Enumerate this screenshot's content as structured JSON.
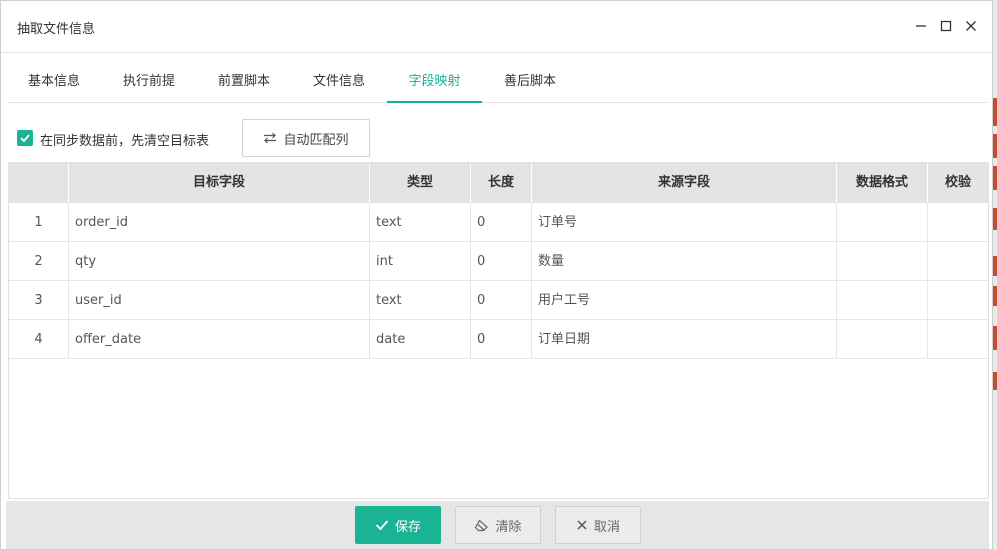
{
  "dialog": {
    "title": "抽取文件信息",
    "icons": {
      "minimize": "minimize-icon",
      "maximize": "maximize-icon",
      "close": "close-icon"
    }
  },
  "tabs": [
    {
      "label": "基本信息",
      "active": false
    },
    {
      "label": "执行前提",
      "active": false
    },
    {
      "label": "前置脚本",
      "active": false
    },
    {
      "label": "文件信息",
      "active": false
    },
    {
      "label": "字段映射",
      "active": true
    },
    {
      "label": "善后脚本",
      "active": false
    }
  ],
  "toolbar": {
    "clear_target_checked": true,
    "clear_target_label": "在同步数据前，先清空目标表",
    "auto_match_label": "自动匹配列",
    "auto_match_icon": "swap-arrows-icon"
  },
  "table": {
    "headers": [
      "",
      "目标字段",
      "类型",
      "长度",
      "来源字段",
      "数据格式",
      "校验"
    ],
    "rows": [
      [
        "1",
        "order_id",
        "text",
        "0",
        "订单号",
        "",
        ""
      ],
      [
        "2",
        "qty",
        "int",
        "0",
        "数量",
        "",
        ""
      ],
      [
        "3",
        "user_id",
        "text",
        "0",
        "用户工号",
        "",
        ""
      ],
      [
        "4",
        "offer_date",
        "date",
        "0",
        "订单日期",
        "",
        ""
      ]
    ]
  },
  "footer": {
    "save_label": "保存",
    "clear_label": "清除",
    "cancel_label": "取消"
  },
  "colors": {
    "accent": "#1ab394",
    "header_bg": "#e4e4e4",
    "footer_bg": "#e6e6e6"
  }
}
